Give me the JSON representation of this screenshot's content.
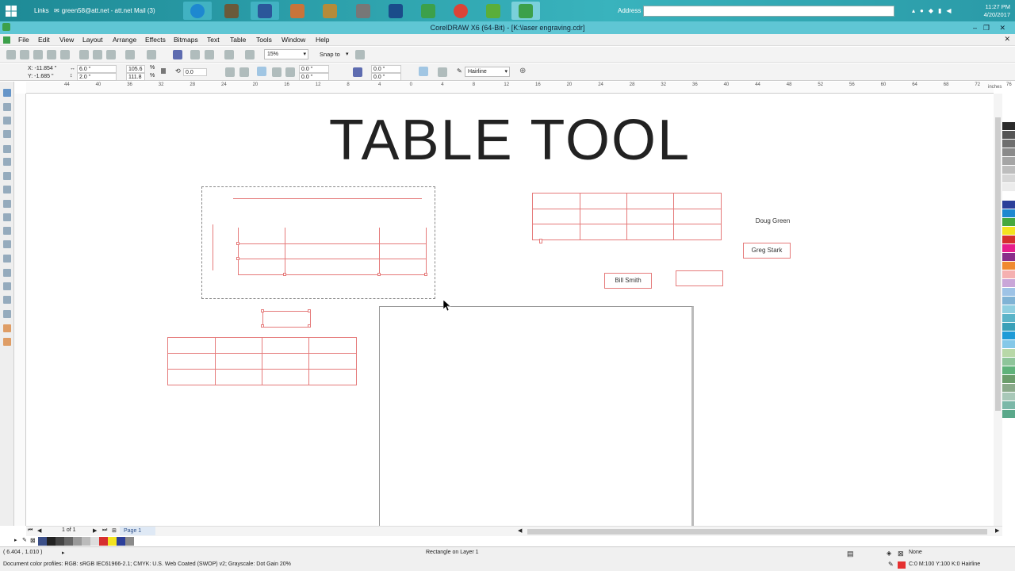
{
  "taskbar": {
    "links_label": "Links",
    "mail_label": "green58@att.net - att.net Mail (3)",
    "address_label": "Address",
    "time": "11:27 PM",
    "date": "4/20/2017"
  },
  "window": {
    "title": "CorelDRAW X6 (64-Bit) - [K:\\laser engraving.cdr]"
  },
  "menu": [
    "File",
    "Edit",
    "View",
    "Layout",
    "Arrange",
    "Effects",
    "Bitmaps",
    "Text",
    "Table",
    "Tools",
    "Window",
    "Help"
  ],
  "toolbar": {
    "zoom": "15%",
    "snap_to": "Snap to"
  },
  "propbar": {
    "x": "X: -11.854 \"",
    "y": "Y: -1.685 \"",
    "width": "6.0 \"",
    "height": "2.0 \"",
    "scale_w": "105.6",
    "scale_h": "111.8",
    "percent": "%",
    "rotation": "0.0",
    "corner1": "0.0 \"",
    "corner2": "0.0 \"",
    "corner3": "0.0 \"",
    "corner4": "0.0 \"",
    "outline": "Hairline"
  },
  "ruler": {
    "h_ticks": [
      "44",
      "40",
      "36",
      "32",
      "28",
      "24",
      "20",
      "16",
      "12",
      "8",
      "4",
      "0",
      "4",
      "8",
      "12",
      "16",
      "20",
      "24",
      "28",
      "32",
      "36",
      "40",
      "44",
      "48",
      "52",
      "56",
      "60",
      "64",
      "68",
      "72",
      "76"
    ],
    "units": "inches"
  },
  "canvas": {
    "heading": "TABLE TOOL",
    "labels": {
      "doug": "Doug Green",
      "greg": "Greg Stark",
      "bill": "Bill Smith"
    }
  },
  "pager": {
    "count": "1 of 1",
    "page_tab": "Page 1"
  },
  "status": {
    "coords": "( 6.404 , 1.010 )",
    "selection": "Rectangle on Layer 1",
    "profiles": "Document color profiles: RGB: sRGB IEC61966-2.1; CMYK: U.S. Web Coated (SWOP) v2; Grayscale: Dot Gain 20%",
    "fill": "None",
    "outline": "C:0 M:100 Y:100 K:0  Hairline"
  },
  "palette_colors": [
    "#ffffff",
    "#2b2b2b",
    "#555555",
    "#6e6e6e",
    "#8a8a8a",
    "#a5a5a5",
    "#bdbdbd",
    "#d6d6d6",
    "#ececec",
    "#ffffff",
    "#2c3f9a",
    "#1e88d0",
    "#46a83f",
    "#f3e321",
    "#d62f2f",
    "#e61e8c",
    "#8a2d8a",
    "#f08a30",
    "#f5b0b0",
    "#c9a6d8",
    "#9ec3e6",
    "#7fb3d5",
    "#8fcfe0",
    "#5ab4c8",
    "#3aa0b8",
    "#1f9bd7",
    "#84c8e8",
    "#b8d8a8",
    "#8ec59a",
    "#5fb27a",
    "#6b9d6b",
    "#8aaa8a",
    "#a8c8b8",
    "#7bb8a8",
    "#5aa88a"
  ],
  "bottom_swatches": [
    "#3b4f88",
    "#222222",
    "#444444",
    "#666666",
    "#999999",
    "#bbbbbb",
    "#dddddd",
    "#d62f2f",
    "#f3e321",
    "#2c3f9a",
    "#8a8a8a"
  ]
}
